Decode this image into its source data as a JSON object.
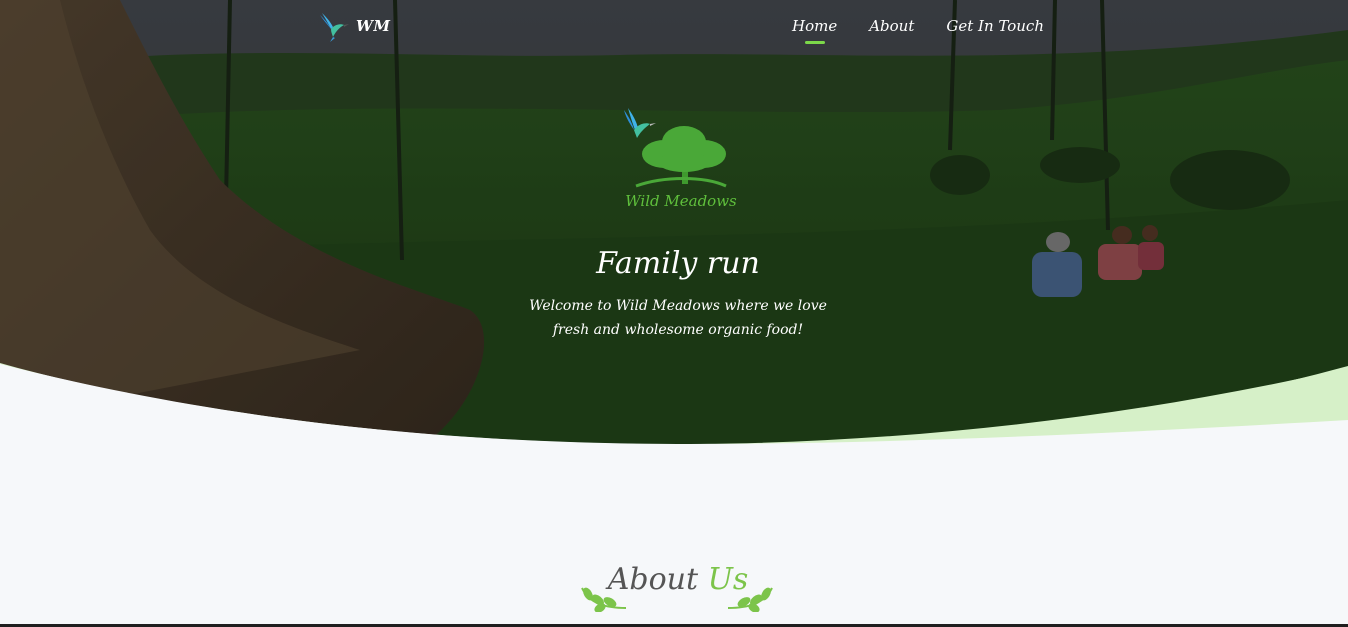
{
  "nav": {
    "brand_text": "WM",
    "brand_icon": "hummingbird-icon",
    "items": [
      {
        "label": "Home",
        "active": true
      },
      {
        "label": "About",
        "active": false
      },
      {
        "label": "Get In Touch",
        "active": false
      }
    ]
  },
  "hero": {
    "logo_text": "Wild Meadows",
    "logo_icons": [
      "hummingbird-icon",
      "tree-icon"
    ],
    "headline": "Family run",
    "tagline": "Welcome to Wild Meadows where we love fresh and wholesome organic food!"
  },
  "about": {
    "title_main": "About",
    "title_accent": "Us",
    "decoration_icon": "sprig-icon"
  },
  "colors": {
    "accent_green": "#7cd84a",
    "wave_green": "#d6f0c8",
    "page_bg": "#f6f8fa"
  }
}
